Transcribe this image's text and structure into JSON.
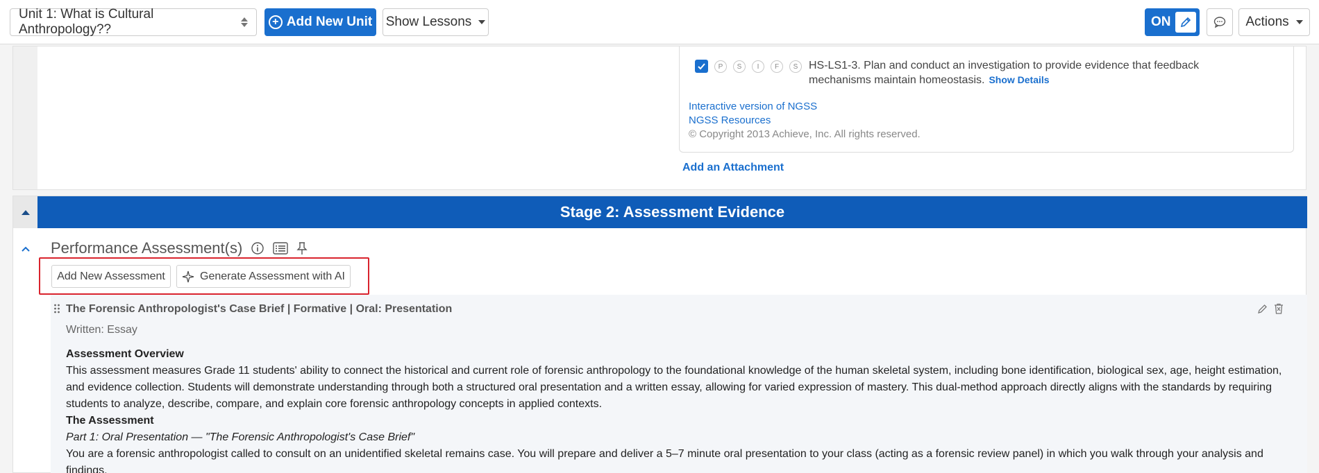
{
  "toolbar": {
    "unit_select_value": "Unit 1: What is Cultural Anthropology??",
    "add_unit_label": "Add New Unit",
    "show_lessons_label": "Show Lessons",
    "toggle_label": "ON",
    "actions_label": "Actions"
  },
  "standards": {
    "pills": [
      "P",
      "S",
      "I",
      "F",
      "S"
    ],
    "item_text": "HS-LS1-3. Plan and conduct an investigation to provide evidence that feedback mechanisms maintain homeostasis.",
    "show_details": "Show Details",
    "link_interactive": "Interactive version of NGSS",
    "link_resources": "NGSS Resources",
    "copyright": "© Copyright 2013 Achieve, Inc. All rights reserved."
  },
  "stage1": {
    "add_attachment": "Add an Attachment"
  },
  "stage2": {
    "banner": "Stage 2: Assessment Evidence",
    "section_title": "Performance Assessment(s)",
    "add_assessment_label": "Add New Assessment",
    "generate_ai_label": "Generate Assessment with AI"
  },
  "assessment": {
    "title": "The Forensic Anthropologist's Case Brief | Formative | Oral: Presentation",
    "subtitle": "Written: Essay",
    "overview_heading": "Assessment Overview",
    "overview_text": "This assessment measures Grade 11 students' ability to connect the historical and current role of forensic anthropology to the foundational knowledge of the human skeletal system, including bone identification, biological sex, age, height estimation, and evidence collection. Students will demonstrate understanding through both a structured oral presentation and a written essay, allowing for varied expression of mastery. This dual-method approach directly aligns with the standards by requiring students to analyze, describe, compare, and explain core forensic anthropology concepts in applied contexts.",
    "assessment_heading": "The Assessment",
    "part1_title": "Part 1: Oral Presentation — \"The Forensic Anthropologist's Case Brief\"",
    "part1_text": "You are a forensic anthropologist called to consult on an unidentified skeletal remains case. You will prepare and deliver a 5–7 minute oral presentation to your class (acting as a forensic review panel) in which you walk through your analysis and findings."
  }
}
